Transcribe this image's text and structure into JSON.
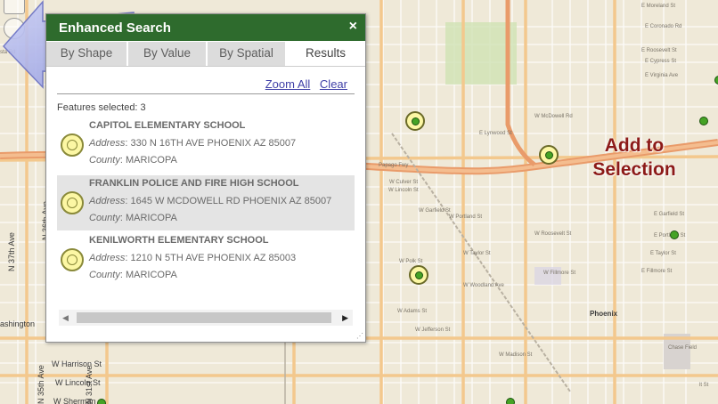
{
  "panel": {
    "title": "Enhanced Search",
    "close_glyph": "×",
    "tabs": [
      "By Shape",
      "By Value",
      "By Spatial",
      "Results"
    ],
    "active_tab": "Results",
    "actions": {
      "zoom_all": "Zoom All",
      "clear": "Clear"
    },
    "features_selected": "Features selected: 3",
    "results": [
      {
        "name": "CAPITOL ELEMENTARY SCHOOL",
        "address_label": "Address",
        "address": ": 330 N 16TH AVE PHOENIX AZ 85007",
        "county_label": "County",
        "county": ": MARICOPA",
        "highlighted": false
      },
      {
        "name": "FRANKLIN POLICE AND FIRE HIGH SCHOOL",
        "address_label": "Address",
        "address": ": 1645 W MCDOWELL RD PHOENIX AZ 85007",
        "county_label": "County",
        "county": ": MARICOPA",
        "highlighted": true
      },
      {
        "name": "KENILWORTH ELEMENTARY SCHOOL",
        "address_label": "Address",
        "address": ": 1210 N 5TH AVE PHOENIX AZ 85003",
        "county_label": "County",
        "county": ": MARICOPA",
        "highlighted": false
      }
    ],
    "scroll_left": "◀",
    "scroll_right": "▶",
    "resize_grip": "⋰"
  },
  "callout": {
    "line1": "Add to",
    "line2": "Selection",
    "color": "#8c1a18"
  },
  "map": {
    "city": "Phoenix",
    "labels_horizontal": [
      "sta Rd",
      "N 36th Ave",
      "N 37th Ave",
      "ashington",
      "W Harrison St",
      "W Lincoln St",
      "W Sherman",
      "N 35th Ave",
      "N 31st Ave",
      "E Moreland St",
      "E Lynwood St",
      "Papago Fwy",
      "W McDowell Rd",
      "W Culver St",
      "W Lincoln St",
      "W Garfield St",
      "W Portland St",
      "W Roosevelt St",
      "W Taylor St",
      "W Polk St",
      "W Fillmore St",
      "W Woodland Ave",
      "W Adams St",
      "W Jefferson St",
      "W Madison St",
      "E Garfield St",
      "E Portland St",
      "E Taylor St",
      "E Fillmore St",
      "E Roosevelt St",
      "E Coronado Rd",
      "E Cypress St",
      "E Virginia Ave",
      "Chase Field",
      "lt St"
    ],
    "brand_green": "#2e6b2d",
    "marker_color": "#45a325"
  }
}
